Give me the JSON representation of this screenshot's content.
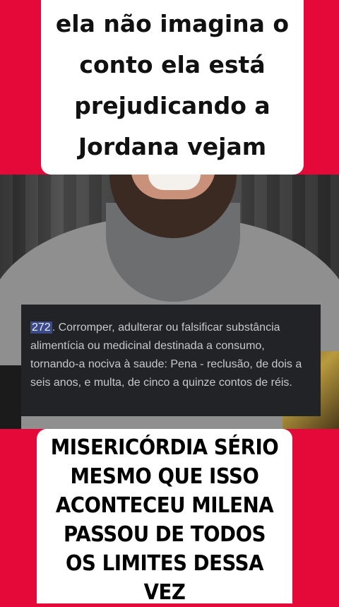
{
  "top_caption": "ela não imagina o conto ela está prejudicando a Jordana vejam",
  "legal_text": {
    "article_number": "272",
    "body": ". Corromper, adulterar ou falsificar substância alimentícia ou medicinal destinada a consumo, tornando-a nociva à saude: Pena - reclusão, de dois a seis anos, e multa, de cinco a quinze contos de réis."
  },
  "bottom_caption": "MISERICÓRDIA SÉRIO MESMO QUE ISSO ACONTECEU MILENA PASSOU DE TODOS OS LIMITES DESSA VEZ",
  "colors": {
    "background": "#e5093a",
    "caption_card": "#ffffff",
    "legal_box": "#222326",
    "legal_highlight": "#3d4a8a"
  }
}
